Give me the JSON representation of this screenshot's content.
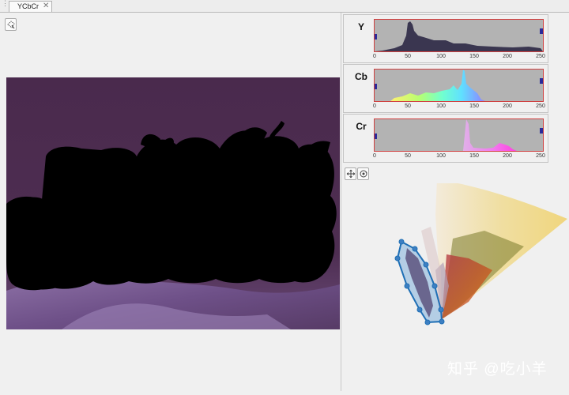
{
  "tabs": [
    {
      "label": "YCbCr",
      "close": "✕"
    }
  ],
  "toolbar": {
    "icon": "lasso-select-icon"
  },
  "histograms": [
    {
      "channel": "Y",
      "ticks": [
        "0",
        "50",
        "100",
        "150",
        "200",
        "250"
      ]
    },
    {
      "channel": "Cb",
      "ticks": [
        "0",
        "50",
        "100",
        "150",
        "200",
        "250"
      ]
    },
    {
      "channel": "Cr",
      "ticks": [
        "0",
        "50",
        "100",
        "150",
        "200",
        "250"
      ]
    }
  ],
  "scatter_tools": {
    "icons": [
      "freehand-polygon-icon",
      "rotate-3d-icon"
    ]
  },
  "colors": {
    "background": "#f0f0f0",
    "image_bg": "#4a2a4d",
    "hist_bg": "#b3b3b3",
    "polygon": "#1f6fb5"
  },
  "watermark": "知乎 @吃小羊"
}
